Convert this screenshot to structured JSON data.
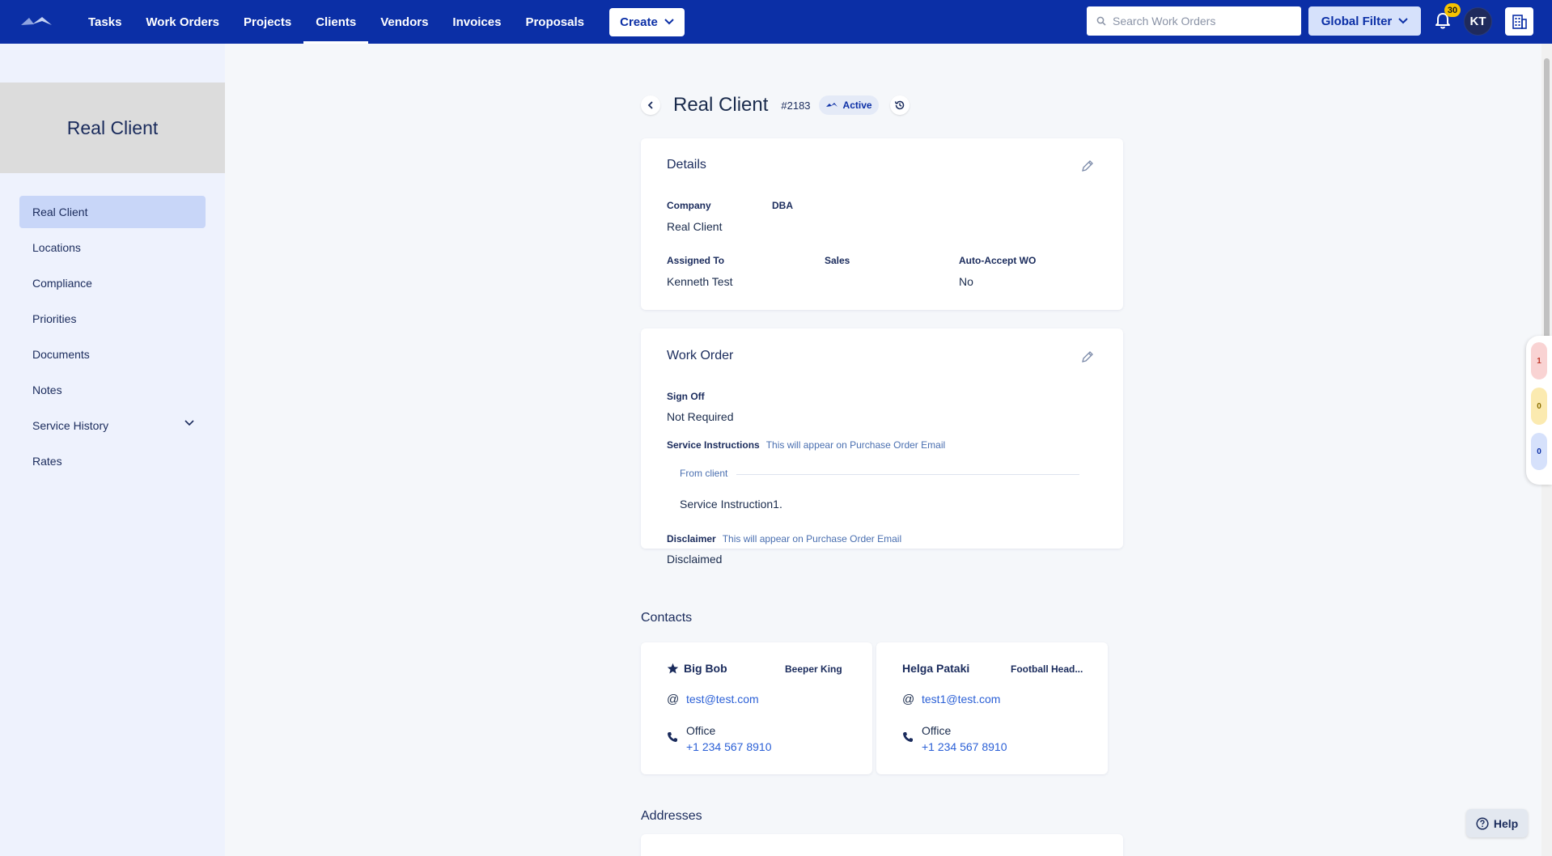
{
  "nav": {
    "links": [
      "Tasks",
      "Work Orders",
      "Projects",
      "Clients",
      "Vendors",
      "Invoices",
      "Proposals"
    ],
    "active": "Clients",
    "create_label": "Create",
    "search_placeholder": "Search Work Orders",
    "global_filter_label": "Global Filter",
    "notification_count": "30",
    "avatar_initials": "KT"
  },
  "sidebar": {
    "title": "Real Client",
    "items": [
      {
        "label": "Real Client",
        "active": true
      },
      {
        "label": "Locations"
      },
      {
        "label": "Compliance"
      },
      {
        "label": "Priorities"
      },
      {
        "label": "Documents"
      },
      {
        "label": "Notes"
      },
      {
        "label": "Service History",
        "expandable": true
      },
      {
        "label": "Rates"
      }
    ]
  },
  "header": {
    "title": "Real Client",
    "id": "#2183",
    "status": "Active"
  },
  "details": {
    "title": "Details",
    "company_label": "Company",
    "company_value": "Real Client",
    "dba_label": "DBA",
    "assigned_label": "Assigned To",
    "assigned_value": "Kenneth Test",
    "sales_label": "Sales",
    "auto_accept_label": "Auto-Accept WO",
    "auto_accept_value": "No"
  },
  "work_order": {
    "title": "Work Order",
    "sign_off_label": "Sign Off",
    "sign_off_value": "Not Required",
    "service_instructions_label": "Service Instructions",
    "service_instructions_hint": "This will appear on Purchase Order Email",
    "from_client_label": "From client",
    "service_instruction_text": "Service Instruction1.",
    "disclaimer_label": "Disclaimer",
    "disclaimer_hint": "This will appear on Purchase Order Email",
    "disclaimer_value": "Disclaimed"
  },
  "contacts": {
    "title": "Contacts",
    "items": [
      {
        "name": "Big Bob",
        "title": "Beeper King",
        "email": "test@test.com",
        "phone_label": "Office",
        "phone": "+1 234 567 8910",
        "primary": true
      },
      {
        "name": "Helga Pataki",
        "title": "Football Head...",
        "email": "test1@test.com",
        "phone_label": "Office",
        "phone": "+1 234 567 8910",
        "primary": false
      }
    ]
  },
  "addresses": {
    "title": "Addresses"
  },
  "side_widget": {
    "counts": [
      "1",
      "0",
      "0"
    ],
    "colors": [
      "#f9d3d3",
      "#fbeab0",
      "#d6e1fb"
    ]
  },
  "help_label": "Help"
}
